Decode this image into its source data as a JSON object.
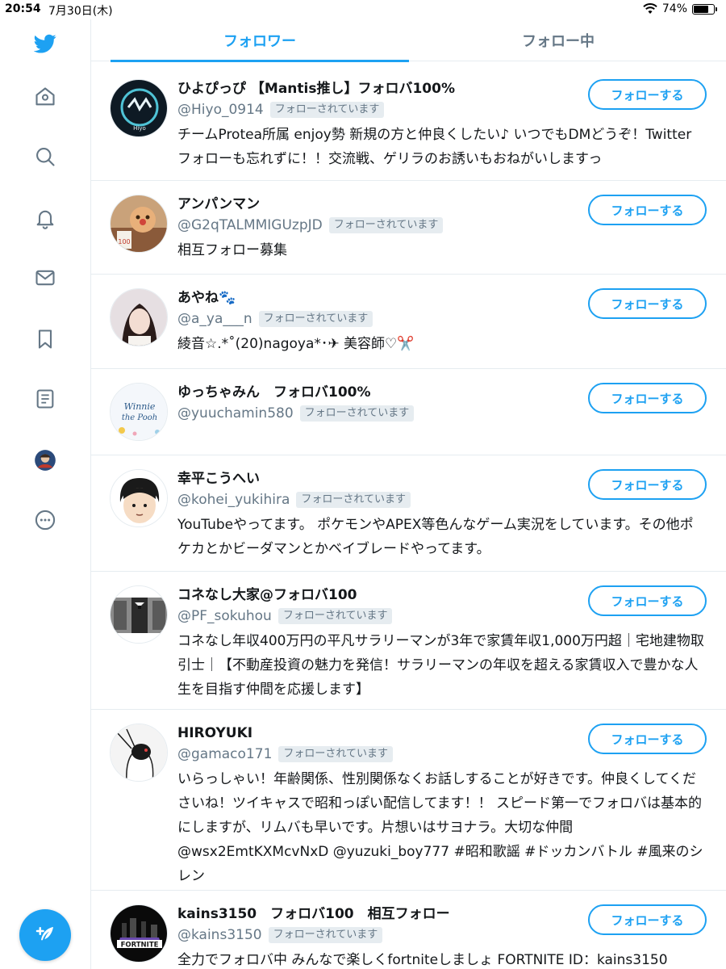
{
  "status_bar": {
    "time": "20:54",
    "date": "7月30日(木)",
    "battery": "74%",
    "battery_level": 0.74
  },
  "sidebar": {
    "items": [
      {
        "icon": "twitter-logo-icon"
      },
      {
        "icon": "home-icon"
      },
      {
        "icon": "search-icon"
      },
      {
        "icon": "notifications-bell-icon"
      },
      {
        "icon": "messages-envelope-icon"
      },
      {
        "icon": "bookmark-icon"
      },
      {
        "icon": "lists-icon"
      },
      {
        "icon": "profile-avatar-icon"
      },
      {
        "icon": "more-icon"
      }
    ],
    "compose_icon": "compose-tweet-icon"
  },
  "tabs": [
    {
      "label": "フォロワー",
      "active": true
    },
    {
      "label": "フォロー中",
      "active": false
    }
  ],
  "follow_label": "フォローする",
  "follows_you_label": "フォローされています",
  "colors": {
    "accent": "#1da1f2",
    "secondary_text": "#657786",
    "divider": "#e6ecf0"
  },
  "users": [
    {
      "name": "ひよぴっぴ 【Mantis推し】フォロバ100%",
      "handle": "@Hiyo_0914",
      "bio": "チームProtea所属 enjoy勢 新規の方と仲良くしたい♪ いつでもDMどうぞ！Twitterフォローも忘れずに！！交流戦、ゲリラのお誘いもおねがいしますっ"
    },
    {
      "name": "アンパンマン",
      "handle": "@G2qTALMMIGUzpJD",
      "bio": "相互フォロー募集"
    },
    {
      "name": "あやね🐾",
      "handle": "@a_ya___n",
      "bio": "綾音☆.*˚(20)nagoya*･✈ 美容師♡✂️"
    },
    {
      "name": "ゆっちゃみん　フォロバ100%",
      "handle": "@yuuchamin580",
      "bio": ""
    },
    {
      "name": "幸平こうへい",
      "handle": "@kohei_yukihira",
      "bio": "YouTubeやってます。 ポケモンやAPEX等色んなゲーム実況をしています。その他ポケカとかビーダマンとかベイブレードやってます。"
    },
    {
      "name": "コネなし大家@フォロバ100",
      "handle": "@PF_sokuhou",
      "bio": "コネなし年収400万円の平凡サラリーマンが3年で家賃年収1,000万円超｜宅地建物取引士｜【不動産投資の魅力を発信！サラリーマンの年収を超える家賃収入で豊かな人生を目指す仲間を応援します】"
    },
    {
      "name": "HIROYUKI",
      "handle": "@gamaco171",
      "bio": "いらっしゃい！年齢関係、性別関係なくお話しすることが好きです。仲良くしてくださいね！ツイキャスで昭和っぽい配信してます！！ スピード第一でフォロバは基本的にしますが、リムバも早いです。片想いはサヨナラ。大切な仲間@wsx2EmtKXMcvNxD @yuzuki_boy777 #昭和歌謡 #ドッカンバトル #風来のシレン"
    },
    {
      "name": "kains3150　フォロバ100　相互フォロー",
      "handle": "@kains3150",
      "bio": "全力でフォロバ中 みんなで楽しくfortniteしましょ FORTNITE ID：kains3150"
    }
  ]
}
